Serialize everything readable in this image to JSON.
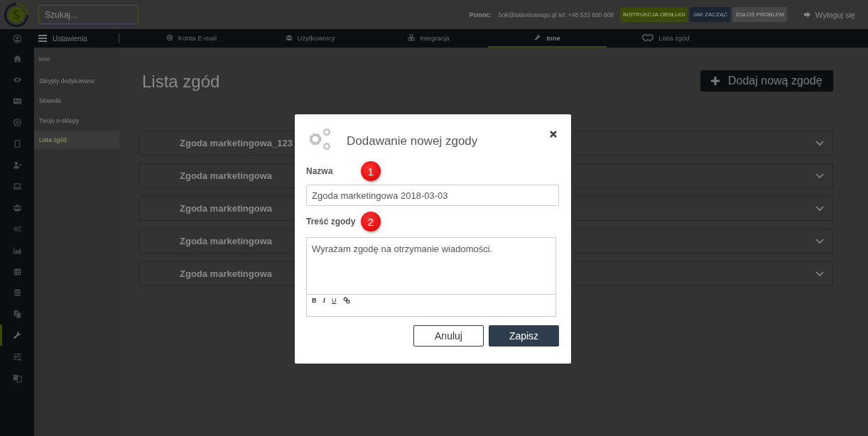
{
  "top_bar": {
    "search": {
      "placeholder": "Szukaj..."
    },
    "help_label": "Pomoc:",
    "contact": "bok@salesmanago.pl tel: +48 533 600 808",
    "buttons": [
      {
        "label": "INSTRUKCJA OBSŁUGI",
        "kind": "green"
      },
      {
        "label": "JAK ZACZĄĆ",
        "kind": "navy"
      },
      {
        "label": "ZGŁOŚ PROBLEM",
        "kind": "gray"
      }
    ],
    "logout": "Wyloguj się"
  },
  "nav": {
    "title": "Ustawienia",
    "tabs": [
      {
        "label": "Konta E-mail",
        "selected": false
      },
      {
        "label": "Użytkownicy",
        "selected": false
      },
      {
        "label": "Integracja",
        "selected": false
      },
      {
        "label": "Inne",
        "selected": true
      },
      {
        "label": "Lista zgód",
        "selected": false
      }
    ]
  },
  "icon_rail": [
    {
      "selected": false
    },
    {
      "selected": false
    },
    {
      "selected": false
    },
    {
      "selected": false
    },
    {
      "selected": false
    },
    {
      "selected": false
    },
    {
      "selected": false
    },
    {
      "selected": false
    },
    {
      "selected": false
    },
    {
      "selected": false
    },
    {
      "selected": false
    },
    {
      "selected": false
    },
    {
      "selected": false
    },
    {
      "selected": false
    },
    {
      "selected": true
    },
    {
      "selected": false
    },
    {
      "selected": false
    }
  ],
  "submenu": {
    "header": "Inne",
    "items": [
      {
        "label": "Skrypty dedykowane",
        "selected": false
      },
      {
        "label": "Słowniki",
        "selected": false
      },
      {
        "label": "Twoje e-sklepy",
        "selected": false
      },
      {
        "label": "Lista zgód",
        "selected": true
      }
    ]
  },
  "page": {
    "title": "Lista zgód",
    "add_button": "Dodaj nową zgodę",
    "consents": [
      {
        "name": "Zgoda marketingowa_123"
      },
      {
        "name": "Zgoda marketingowa"
      },
      {
        "name": "Zgoda marketingowa"
      },
      {
        "name": "Zgoda marketingowa"
      },
      {
        "name": "Zgoda marketingowa"
      }
    ]
  },
  "dialog": {
    "title": "Dodawanie nowej zgody",
    "name_field": {
      "label": "Nazwa",
      "badge": "1",
      "value": "Zgoda marketingowa 2018-03-03"
    },
    "content_field": {
      "label": "Treść zgody",
      "badge": "2",
      "value": "Wyrażam zgodę na otrzymanie wiadomości.",
      "toolbar": [
        "B",
        "I",
        "U"
      ]
    },
    "buttons": [
      {
        "label": "Anuluj",
        "kind": "secondary"
      },
      {
        "label": "Zapisz",
        "kind": "primary"
      }
    ]
  }
}
